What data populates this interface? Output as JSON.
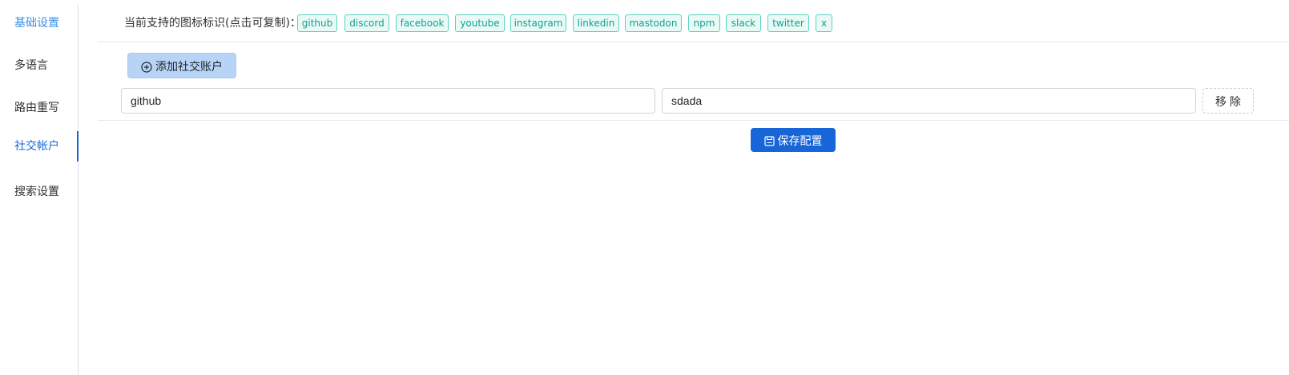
{
  "sidebar": {
    "items": [
      {
        "label": "基础设置",
        "state": "hover"
      },
      {
        "label": "多语言",
        "state": "normal"
      },
      {
        "label": "路由重写",
        "state": "normal"
      },
      {
        "label": "社交帐户",
        "state": "active"
      },
      {
        "label": "搜索设置",
        "state": "normal"
      }
    ]
  },
  "icons_section": {
    "label": "当前支持的图标标识(点击可复制)：",
    "tags": [
      "github",
      "discord",
      "facebook",
      "youtube",
      "instagram",
      "linkedin",
      "mastodon",
      "npm",
      "slack",
      "twitter",
      "x"
    ]
  },
  "social": {
    "add_button_label": "添加社交账户",
    "add_icon": "plus-circle-icon",
    "rows": [
      {
        "platform": "github",
        "link": "sdada",
        "remove_label": "移 除"
      }
    ]
  },
  "save_button_label": "保存配置",
  "save_icon": "save-icon",
  "colors": {
    "accent": "#1765d8",
    "tag_text": "#13a08d",
    "tag_border": "#5cd2c0",
    "tag_bg": "#e9faf6",
    "add_button_bg": "#b7d4f6"
  }
}
